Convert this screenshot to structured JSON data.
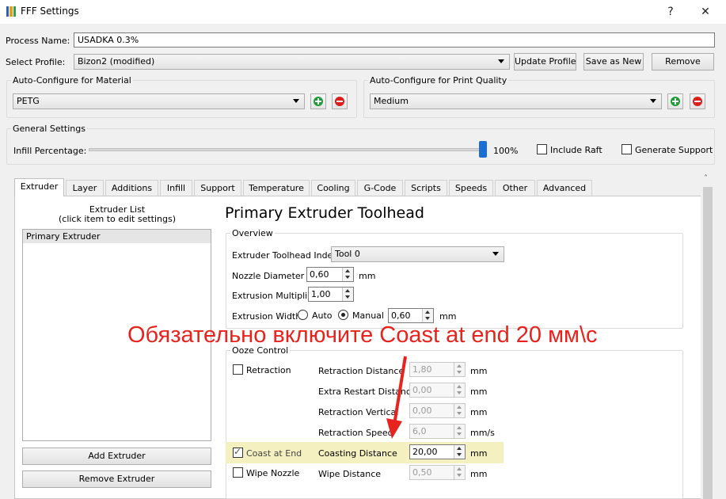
{
  "window": {
    "title": "FFF Settings",
    "help": "?",
    "close": "✕"
  },
  "process": {
    "label": "Process Name:",
    "value": "USADKA 0.3%"
  },
  "profile": {
    "label": "Select Profile:",
    "value": "Bizon2 (modified)",
    "update": "Update Profile",
    "save_as_new": "Save as New",
    "remove": "Remove"
  },
  "material": {
    "title": "Auto-Configure for Material",
    "value": "PETG"
  },
  "quality": {
    "title": "Auto-Configure for Print Quality",
    "value": "Medium"
  },
  "general": {
    "title": "General Settings",
    "infill_label": "Infill Percentage:",
    "infill_value": "100%",
    "infill_fraction": 1.0,
    "include_raft": "Include Raft",
    "generate_support": "Generate Support"
  },
  "tabs": [
    "Extruder",
    "Layer",
    "Additions",
    "Infill",
    "Support",
    "Temperature",
    "Cooling",
    "G-Code",
    "Scripts",
    "Speeds",
    "Other",
    "Advanced"
  ],
  "extruder_list": {
    "title": "Extruder List",
    "hint": "(click item to edit settings)",
    "items": [
      "Primary Extruder"
    ],
    "add": "Add Extruder",
    "remove": "Remove Extruder"
  },
  "toolhead": {
    "heading": "Primary Extruder Toolhead",
    "overview_title": "Overview",
    "index_label": "Extruder Toolhead Index",
    "index_value": "Tool 0",
    "nozzle_label": "Nozzle Diameter",
    "nozzle_value": "0,60",
    "nozzle_unit": "mm",
    "mult_label": "Extrusion Multiplier",
    "mult_value": "1,00",
    "width_label": "Extrusion Width",
    "width_auto": "Auto",
    "width_manual": "Manual",
    "width_value": "0,60",
    "width_unit": "mm"
  },
  "ooze": {
    "title": "Ooze Control",
    "retraction": "Retraction",
    "coast": "Coast at End",
    "wipe": "Wipe Nozzle",
    "rows": [
      {
        "label": "Retraction Distance",
        "value": "1,80",
        "unit": "mm"
      },
      {
        "label": "Extra Restart Distance",
        "value": "0,00",
        "unit": "mm"
      },
      {
        "label": "Retraction Vertical",
        "value": "0,00",
        "unit": "mm"
      },
      {
        "label": "Retraction Speed",
        "value": "6,0",
        "unit": "mm/s"
      },
      {
        "label": "Coasting Distance",
        "value": "20,00",
        "unit": "mm"
      },
      {
        "label": "Wipe Distance",
        "value": "0,50",
        "unit": "mm"
      }
    ]
  },
  "annotation": {
    "text": "Обязательно включите Coast at end 20 мм\\с",
    "color": "#e8231d"
  },
  "colors": {
    "highlight": "#f4f0c0",
    "add_green": "#1e9e3a",
    "remove_red": "#d9201c",
    "slider_blue": "#1a6fd6"
  }
}
